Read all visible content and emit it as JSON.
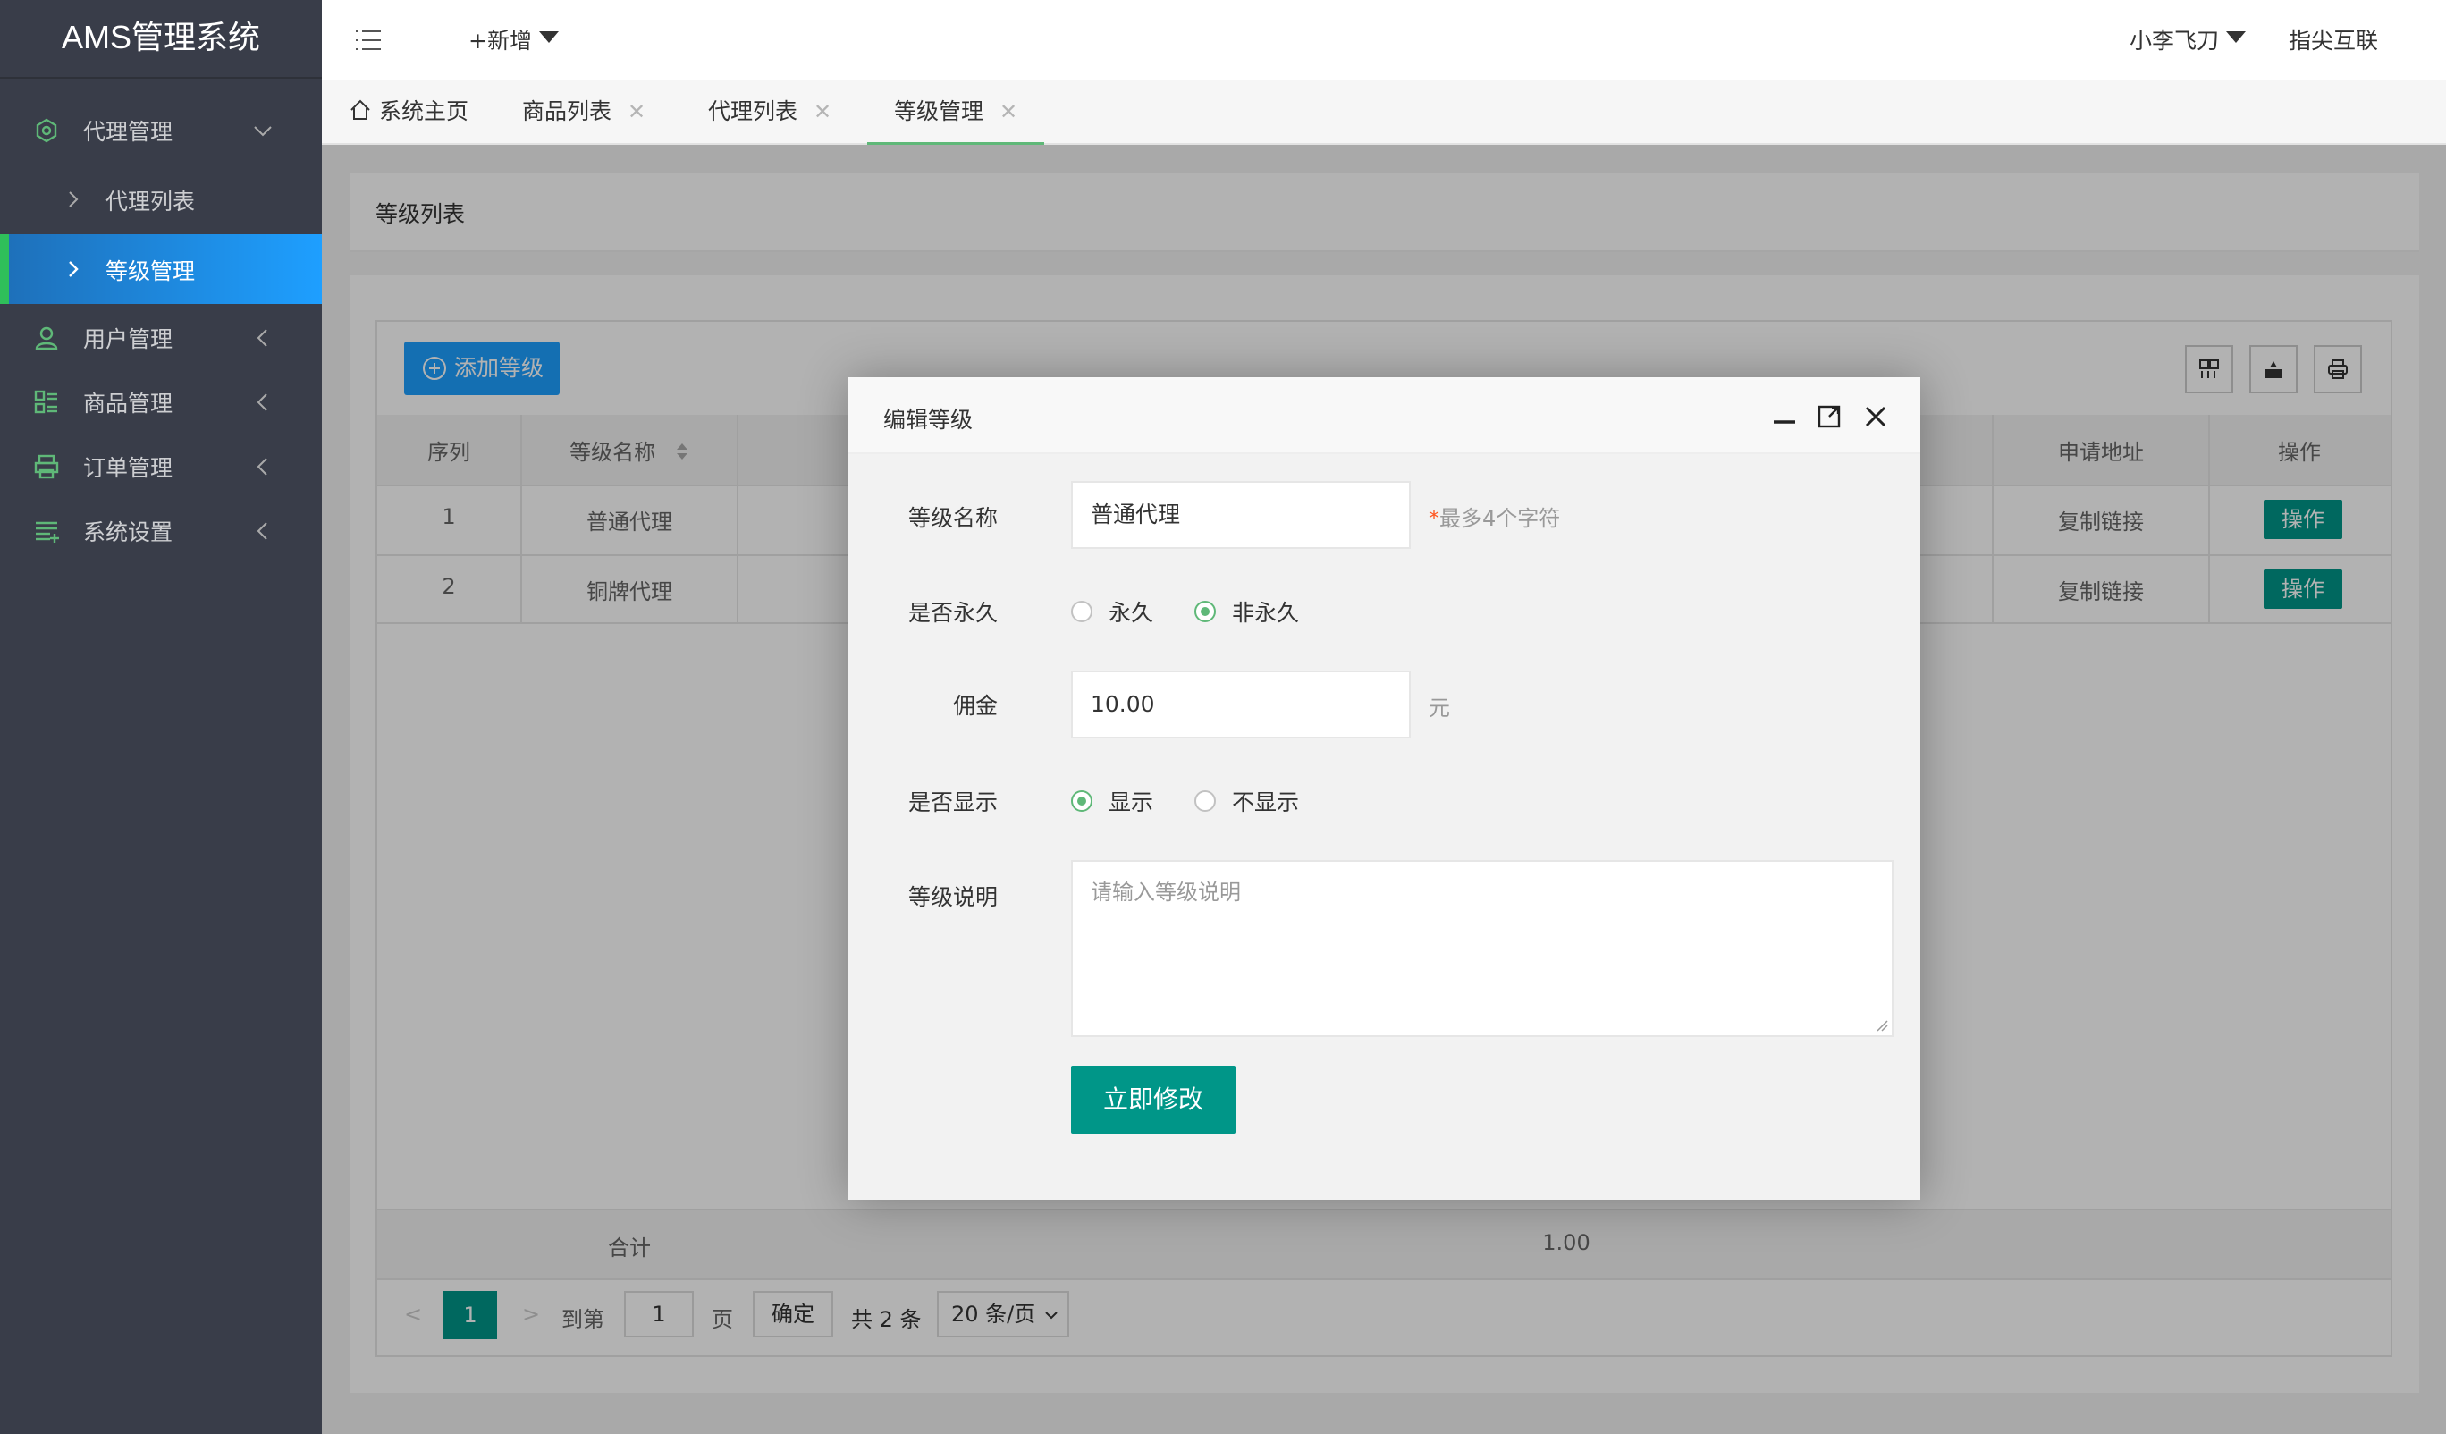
{
  "app": {
    "title": "AMS管理系统"
  },
  "sidebar": {
    "groups": [
      {
        "label": "代理管理",
        "icon": "agent-icon",
        "expanded": true
      },
      {
        "label": "用户管理",
        "icon": "user-icon"
      },
      {
        "label": "商品管理",
        "icon": "goods-icon"
      },
      {
        "label": "订单管理",
        "icon": "order-icon"
      },
      {
        "label": "系统设置",
        "icon": "settings-icon"
      }
    ],
    "sub_items": [
      {
        "label": "代理列表",
        "active": false
      },
      {
        "label": "等级管理",
        "active": true
      }
    ]
  },
  "header": {
    "new_label": "+新增",
    "user_label": "小李飞刀",
    "brand_label": "指尖互联"
  },
  "tabs": [
    {
      "label": "系统主页"
    },
    {
      "label": "商品列表"
    },
    {
      "label": "代理列表"
    },
    {
      "label": "等级管理",
      "active": true
    }
  ],
  "page": {
    "card_title": "等级列表",
    "add_button": "添加等级",
    "table": {
      "headers": [
        "序列",
        "等级名称",
        "申请地址",
        "操作"
      ],
      "rows": [
        {
          "index": "1",
          "name": "普通代理",
          "link": "复制链接",
          "op": "操作"
        },
        {
          "index": "2",
          "name": "铜牌代理",
          "link": "复制链接",
          "op": "操作"
        }
      ],
      "total_label": "合计",
      "total_value": "1.00"
    },
    "pager": {
      "current": "1",
      "goto_label": "到第",
      "page_input": "1",
      "page_unit": "页",
      "confirm": "确定",
      "total": "共 2 条",
      "page_size": "20 条/页"
    }
  },
  "modal": {
    "title": "编辑等级",
    "fields": {
      "name_label": "等级名称",
      "name_value": "普通代理",
      "name_hint_req": "*",
      "name_hint": "最多4个字符",
      "permanent_label": "是否永久",
      "permanent_options": [
        "永久",
        "非永久"
      ],
      "permanent_selected": "非永久",
      "commission_label": "佣金",
      "commission_value": "10.00",
      "commission_unit": "元",
      "display_label": "是否显示",
      "display_options": [
        "显示",
        "不显示"
      ],
      "display_selected": "显示",
      "desc_label": "等级说明",
      "desc_placeholder": "请输入等级说明"
    },
    "submit_label": "立即修改"
  },
  "colors": {
    "sidebar_bg": "#393d49",
    "active_blue": "#1e9fff",
    "primary_green": "#009688",
    "radio_green": "#5fb878"
  }
}
